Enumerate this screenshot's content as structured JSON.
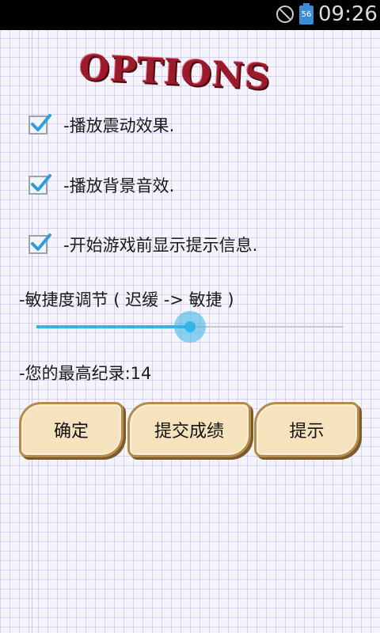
{
  "status_bar": {
    "time": "09:26",
    "battery_level": "56"
  },
  "title": "OPTIONS",
  "options": [
    {
      "label": "-播放震动效果.",
      "checked": true
    },
    {
      "label": "-播放背景音效.",
      "checked": true
    },
    {
      "label": "-开始游戏前显示提示信息.",
      "checked": true
    }
  ],
  "sensitivity": {
    "label": "-敏捷度调节 ( 迟缓 -> 敏捷 )",
    "value_percent": 50
  },
  "high_score": {
    "label": "-您的最高纪录:14"
  },
  "buttons": {
    "confirm": "确定",
    "submit": "提交成绩",
    "hint": "提示"
  },
  "colors": {
    "accent": "#33b5e5",
    "title": "#9c1b2b",
    "button_fill": "#f6e2bd",
    "button_border": "#b68a48"
  }
}
